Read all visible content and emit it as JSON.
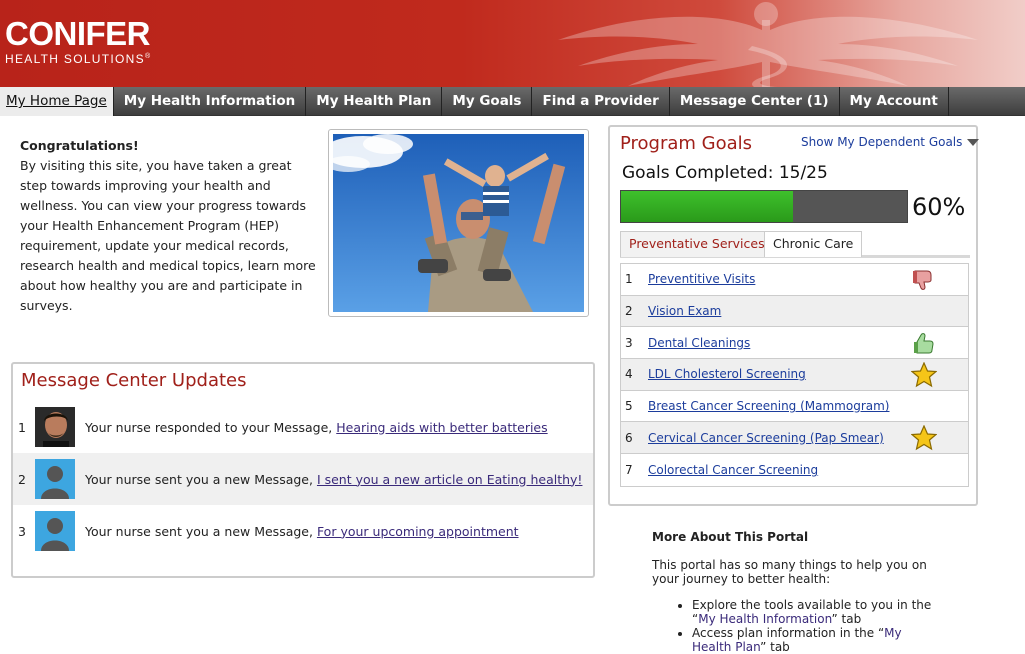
{
  "brand": {
    "name": "CONIFER",
    "subtitle": "HEALTH SOLUTIONS"
  },
  "nav": {
    "items": [
      {
        "label": "My Home Page",
        "active": true
      },
      {
        "label": "My Health Information"
      },
      {
        "label": "My Health Plan"
      },
      {
        "label": "My Goals"
      },
      {
        "label": "Find a Provider"
      },
      {
        "label": "Message Center (1)"
      },
      {
        "label": "My Account"
      }
    ]
  },
  "intro": {
    "title": "Congratulations!",
    "body": "By visiting this site, you have taken a great step towards improving your health and wellness.  You can view your progress towards your Health Enhancement Program (HEP) requirement, update your medical records, research health and medical topics, learn more about how healthy you are and participate in surveys."
  },
  "message_center": {
    "title": "Message Center Updates",
    "messages": [
      {
        "num": "1",
        "text": "Your nurse responded to your Message, ",
        "link": "Hearing aids with better batteries",
        "avatar": "photo"
      },
      {
        "num": "2",
        "text": "Your nurse sent you a new Message, ",
        "link": "I sent you a new article on Eating healthy!",
        "avatar": "default-person-icon"
      },
      {
        "num": "3",
        "text": "Your nurse sent you a new Message, ",
        "link": "For your upcoming appointment",
        "avatar": "default-person-icon"
      }
    ]
  },
  "goals": {
    "title": "Program Goals",
    "dependent_link": "Show My Dependent Goals",
    "completed_label": "Goals Completed: 15/25",
    "progress_percent": 60,
    "progress_text": "60%",
    "tabs": [
      {
        "label": "Preventative Services",
        "active": true
      },
      {
        "label": "Chronic Care"
      }
    ],
    "items": [
      {
        "num": "1",
        "label": "Preventitive Visits",
        "icon": "thumbs-down-icon"
      },
      {
        "num": "2",
        "label": "Vision Exam",
        "icon": ""
      },
      {
        "num": "3",
        "label": "Dental Cleanings",
        "icon": "thumbs-up-icon"
      },
      {
        "num": "4",
        "label": "LDL Cholesterol Screening",
        "icon": "star-icon"
      },
      {
        "num": "5",
        "label": "Breast Cancer Screening (Mammogram)",
        "icon": ""
      },
      {
        "num": "6",
        "label": "Cervical Cancer Screening (Pap Smear)",
        "icon": "star-icon"
      },
      {
        "num": "7",
        "label": "Colorectal Cancer Screening",
        "icon": ""
      }
    ]
  },
  "more": {
    "title": "More About This Portal",
    "body": "This portal has so many things to help you on your journey to better health:",
    "bullet1_pre": "Explore the tools available to you in the “",
    "bullet1_link": "My Health Information",
    "bullet1_post": "” tab",
    "bullet2_pre": "Access plan information in the “",
    "bullet2_link": "My Health Plan",
    "bullet2_post": "” tab"
  },
  "colors": {
    "brand_red": "#b8231a",
    "title_red": "#a0201a",
    "progress_green": "#3ec02c",
    "link_blue": "#1c3d9c"
  }
}
